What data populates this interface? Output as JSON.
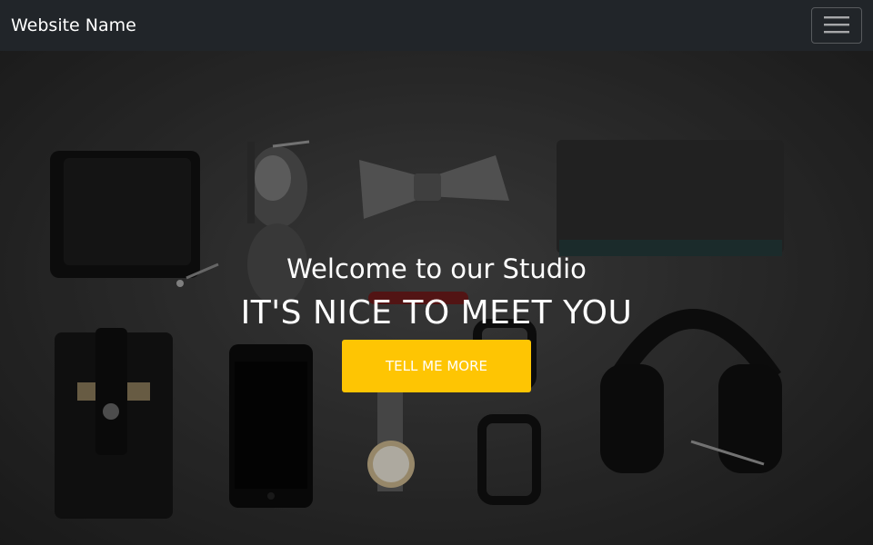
{
  "navbar": {
    "brand": "Website Name",
    "toggler_icon": "hamburger-menu-icon"
  },
  "hero": {
    "lead": "Welcome to our Studio",
    "heading": "IT'S NICE TO MEET YOU",
    "button_label": "TELL ME MORE",
    "button_color": "#fec503",
    "background_icons": [
      "wallet-icon",
      "sunglasses-icon",
      "bow-tie-icon",
      "notebook-icon",
      "pen-icon",
      "card-holder-icon",
      "smartphone-icon",
      "wristwatch-icon",
      "glasses-icon",
      "headphones-icon"
    ]
  },
  "colors": {
    "navbar_bg": "#212529",
    "text": "#ffffff"
  }
}
